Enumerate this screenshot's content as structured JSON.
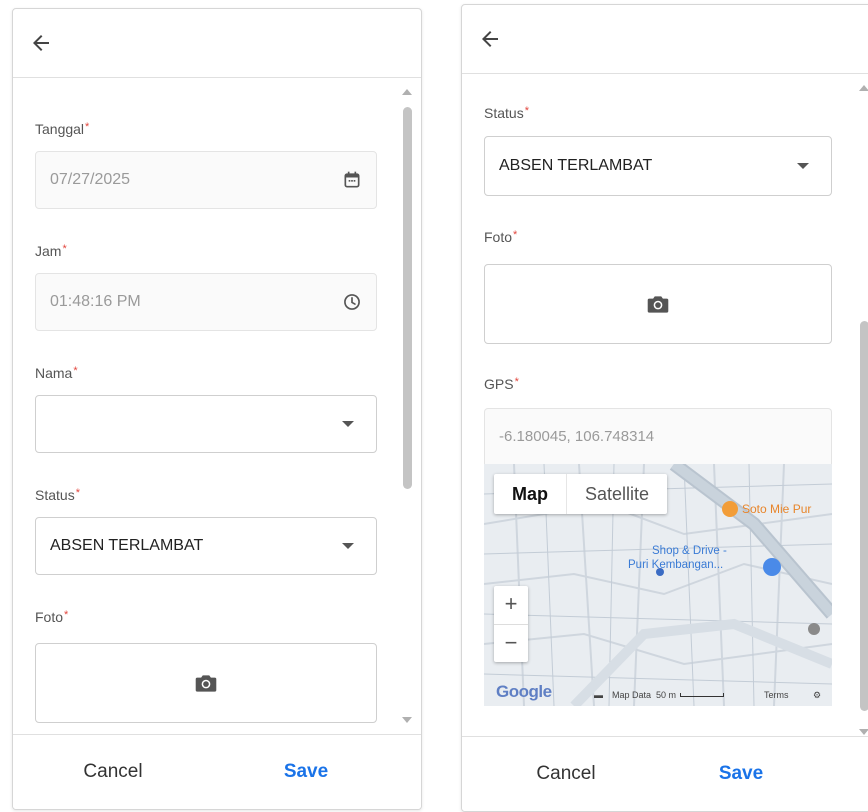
{
  "left": {
    "fields": {
      "tanggal": {
        "label": "Tanggal",
        "required_mark": "*",
        "value": "07/27/2025",
        "icon": "calendar-icon"
      },
      "jam": {
        "label": "Jam",
        "required_mark": "*",
        "value": "01:48:16 PM",
        "icon": "clock-icon"
      },
      "nama": {
        "label": "Nama",
        "required_mark": "*",
        "value": ""
      },
      "status": {
        "label": "Status",
        "required_mark": "*",
        "value": "ABSEN TERLAMBAT"
      },
      "foto": {
        "label": "Foto",
        "required_mark": "*",
        "icon": "camera-icon"
      }
    },
    "footer": {
      "cancel": "Cancel",
      "save": "Save"
    }
  },
  "right": {
    "fields": {
      "status": {
        "label": "Status",
        "required_mark": "*",
        "value": "ABSEN TERLAMBAT"
      },
      "foto": {
        "label": "Foto",
        "required_mark": "*",
        "icon": "camera-icon"
      },
      "gps": {
        "label": "GPS",
        "required_mark": "*",
        "value": "-6.180045, 106.748314"
      }
    },
    "map": {
      "type_options": [
        "Map",
        "Satellite"
      ],
      "selected_type": "Map",
      "zoom_in": "+",
      "zoom_out": "−",
      "poi_1": "Soto Mie Pur",
      "poi_2_line1": "Shop & Drive -",
      "poi_2_line2": "Puri Kembangan...",
      "google_logo": "Google",
      "map_data": "Map Data",
      "scale": "50 m",
      "terms": "Terms"
    },
    "footer": {
      "cancel": "Cancel",
      "save": "Save"
    }
  },
  "colors": {
    "accent": "#1a73e8",
    "required": "#e2463e",
    "poi_orange": "#e8852a",
    "poi_blue": "#3a7bd5"
  }
}
